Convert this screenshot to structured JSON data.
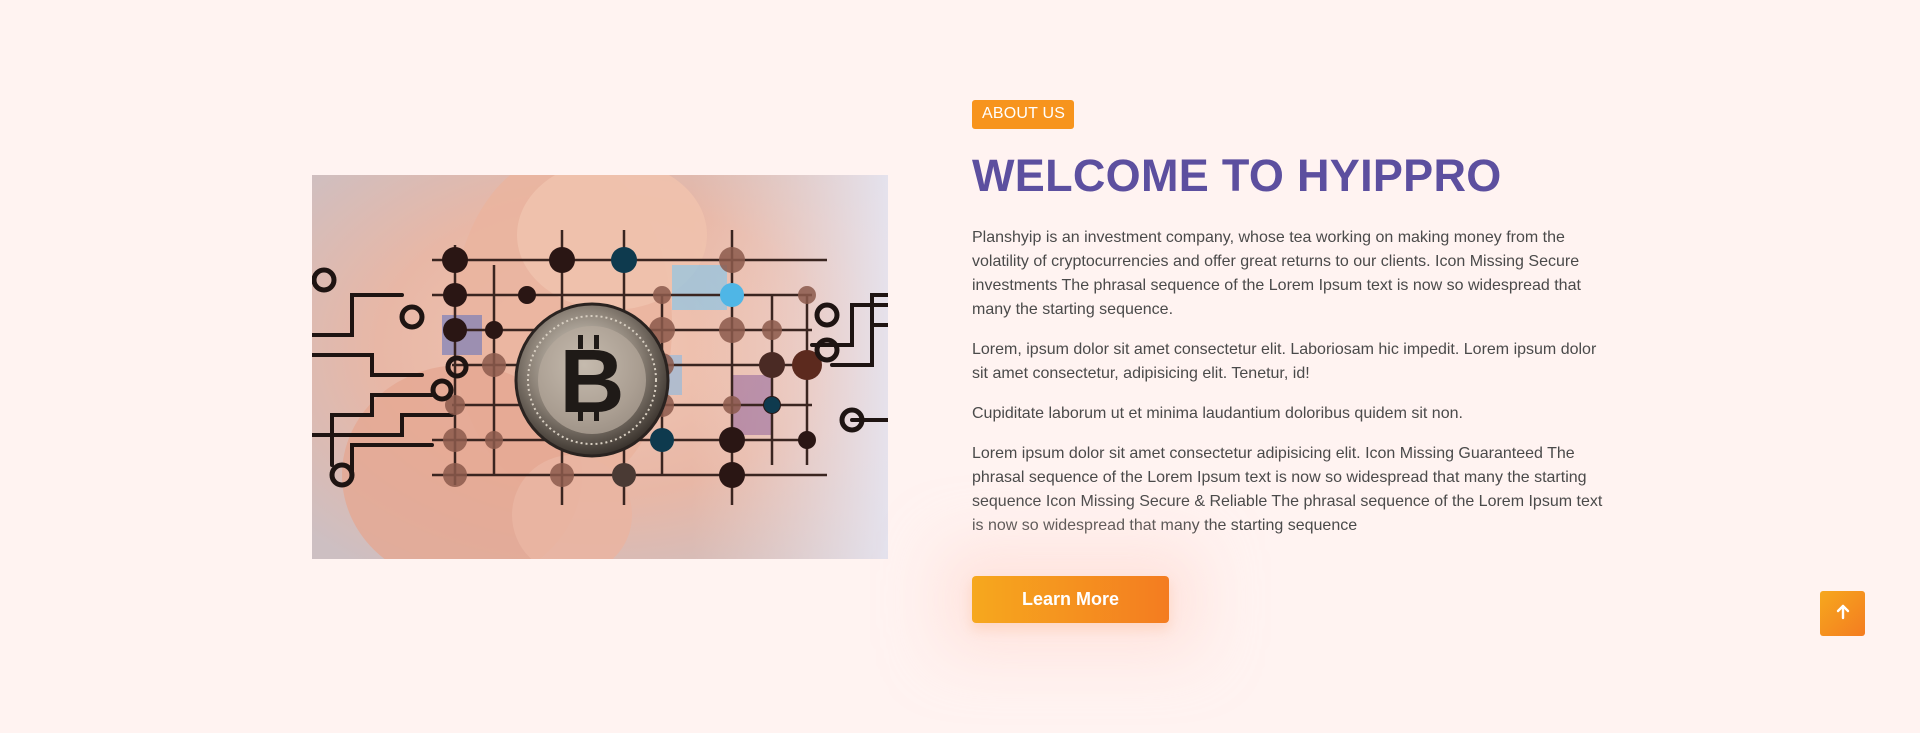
{
  "about": {
    "badge": "ABOUT US",
    "title": "WELCOME TO HYIPPRO",
    "paragraphs": [
      "Planshyip is an investment company, whose tea working on making money from the volatility of cryptocurrencies and offer great returns to our clients. Icon Missing Secure investments The phrasal sequence of the Lorem Ipsum text is now so widespread that many the starting sequence.",
      "Lorem, ipsum dolor sit amet consectetur elit. Laboriosam hic impedit. Lorem ipsum dolor sit amet consectetur, adipisicing elit. Tenetur, id!",
      "Cupiditate laborum ut et minima laudantium doloribus quidem sit non.",
      "Lorem ipsum dolor sit amet consectetur adipisicing elit. Icon Missing Guaranteed The phrasal sequence of the Lorem Ipsum text is now so widespread that many the starting sequence Icon Missing Secure & Reliable The phrasal sequence of the Lorem Ipsum text is now so widespread that many the starting sequence"
    ],
    "cta_label": "Learn More",
    "image_icon": "bitcoin-circuit-image"
  },
  "scroll_top": {
    "icon": "arrow-up-icon"
  },
  "colors": {
    "background": "#fff3f1",
    "accent_orange": "#f7941d",
    "title_purple": "#5c4f9f",
    "body_text": "#4a4a4a"
  }
}
